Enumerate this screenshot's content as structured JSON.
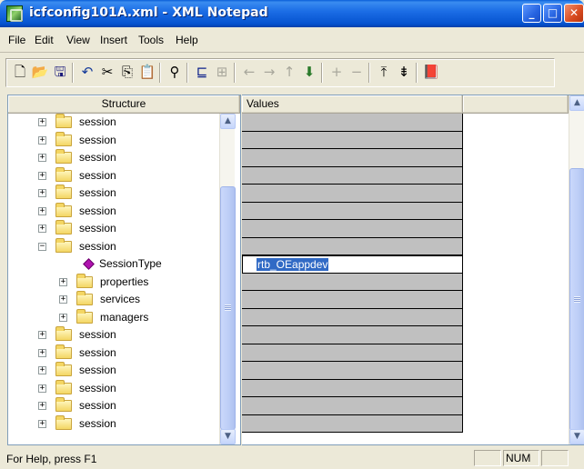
{
  "window": {
    "title": "icfconfig101A.xml - XML Notepad",
    "controls": {
      "minimize": "_",
      "maximize": "□",
      "close": "✕"
    }
  },
  "menu": [
    "File",
    "Edit",
    "View",
    "Insert",
    "Tools",
    "Help"
  ],
  "toolbar": {
    "icons": [
      "new-document-icon",
      "open-folder-icon",
      "save-disk-icon",
      "undo-icon",
      "cut-icon",
      "copy-icon",
      "paste-icon",
      "find-binoculars-icon",
      "insert-child-icon",
      "insert-sibling-icon",
      "nudge-left-icon",
      "nudge-right-icon",
      "nudge-up-icon",
      "nudge-down-icon",
      "expand-all-icon",
      "collapse-all-icon",
      "collapse-to-top-icon",
      "collapse-to-bottom-icon",
      "xml-book-icon"
    ]
  },
  "structure": {
    "header": "Structure",
    "rows": [
      {
        "label": "session",
        "type": "folder",
        "depth": 0,
        "expanded": false
      },
      {
        "label": "session",
        "type": "folder",
        "depth": 0,
        "expanded": false
      },
      {
        "label": "session",
        "type": "folder",
        "depth": 0,
        "expanded": false
      },
      {
        "label": "session",
        "type": "folder",
        "depth": 0,
        "expanded": false
      },
      {
        "label": "session",
        "type": "folder",
        "depth": 0,
        "expanded": false
      },
      {
        "label": "session",
        "type": "folder",
        "depth": 0,
        "expanded": false
      },
      {
        "label": "session",
        "type": "folder",
        "depth": 0,
        "expanded": false
      },
      {
        "label": "session",
        "type": "folder",
        "depth": 0,
        "expanded": true
      },
      {
        "label": "SessionType",
        "type": "attribute",
        "depth": 1
      },
      {
        "label": "properties",
        "type": "folder",
        "depth": 1,
        "expanded": false
      },
      {
        "label": "services",
        "type": "folder",
        "depth": 1,
        "expanded": false
      },
      {
        "label": "managers",
        "type": "folder",
        "depth": 1,
        "expanded": false
      },
      {
        "label": "session",
        "type": "folder",
        "depth": 0,
        "expanded": false
      },
      {
        "label": "session",
        "type": "folder",
        "depth": 0,
        "expanded": false
      },
      {
        "label": "session",
        "type": "folder",
        "depth": 0,
        "expanded": false
      },
      {
        "label": "session",
        "type": "folder",
        "depth": 0,
        "expanded": false
      },
      {
        "label": "session",
        "type": "folder",
        "depth": 0,
        "expanded": false
      },
      {
        "label": "session",
        "type": "folder",
        "depth": 0,
        "expanded": false
      }
    ]
  },
  "values": {
    "header": "Values",
    "editing_row_index": 8,
    "editing_value": "rtb_OEappdev",
    "row_count": 18
  },
  "status": {
    "help": "For Help, press F1",
    "num": "NUM"
  }
}
